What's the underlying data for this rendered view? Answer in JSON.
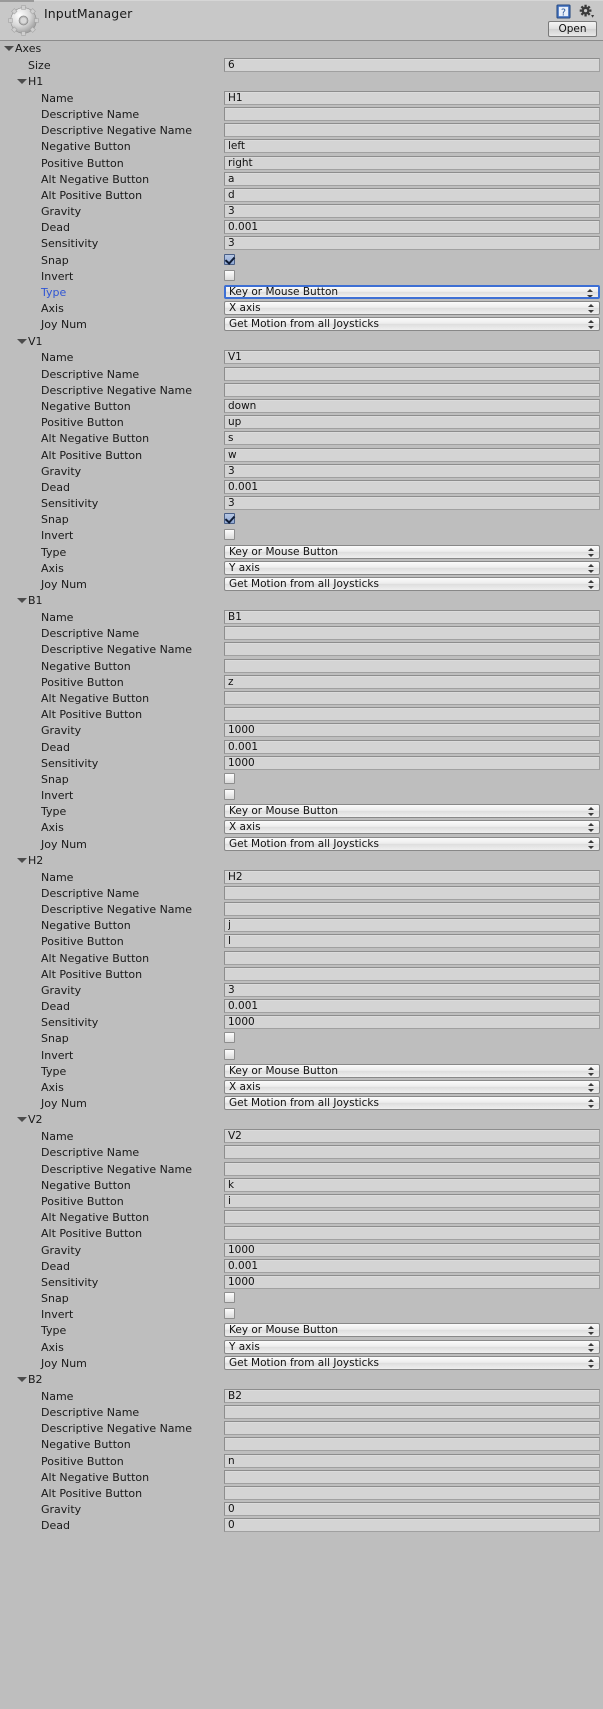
{
  "window": {
    "title": "InputManager",
    "logo_icon": "gear-icon",
    "help_icon": "help-book-icon",
    "settings_icon": "gear-settings-icon",
    "open_label": "Open"
  },
  "labels": {
    "axes": "Axes",
    "size": "Size",
    "name": "Name",
    "descriptive_name": "Descriptive Name",
    "descriptive_negative_name": "Descriptive Negative Name",
    "negative_button": "Negative Button",
    "positive_button": "Positive Button",
    "alt_negative_button": "Alt Negative Button",
    "alt_positive_button": "Alt Positive Button",
    "gravity": "Gravity",
    "dead": "Dead",
    "sensitivity": "Sensitivity",
    "snap": "Snap",
    "invert": "Invert",
    "type": "Type",
    "axis": "Axis",
    "joy_num": "Joy Num"
  },
  "colors": {
    "accent_blue": "#2f55d4",
    "focus_border": "#3d6fd4",
    "panel_bg": "#bebebe",
    "header_bg": "#c8c8c8",
    "field_bg": "#d4d4d4"
  },
  "axes": {
    "size": "6",
    "entries": [
      {
        "id": "H1",
        "name": "H1",
        "descriptive_name": "",
        "descriptive_negative_name": "",
        "negative_button": "left",
        "positive_button": "right",
        "alt_negative_button": "a",
        "alt_positive_button": "d",
        "gravity": "3",
        "dead": "0.001",
        "sensitivity": "3",
        "snap": true,
        "invert": false,
        "type": "Key or Mouse Button",
        "type_focused": true,
        "type_label_highlighted": true,
        "axis": "X axis",
        "joy_num": "Get Motion from all Joysticks"
      },
      {
        "id": "V1",
        "name": "V1",
        "descriptive_name": "",
        "descriptive_negative_name": "",
        "negative_button": "down",
        "positive_button": "up",
        "alt_negative_button": "s",
        "alt_positive_button": "w",
        "gravity": "3",
        "dead": "0.001",
        "sensitivity": "3",
        "snap": true,
        "invert": false,
        "type": "Key or Mouse Button",
        "type_focused": false,
        "type_label_highlighted": false,
        "axis": "Y axis",
        "joy_num": "Get Motion from all Joysticks"
      },
      {
        "id": "B1",
        "name": "B1",
        "descriptive_name": "",
        "descriptive_negative_name": "",
        "negative_button": "",
        "positive_button": "z",
        "alt_negative_button": "",
        "alt_positive_button": "",
        "gravity": "1000",
        "dead": "0.001",
        "sensitivity": "1000",
        "snap": false,
        "invert": false,
        "type": "Key or Mouse Button",
        "type_focused": false,
        "type_label_highlighted": false,
        "axis": "X axis",
        "joy_num": "Get Motion from all Joysticks"
      },
      {
        "id": "H2",
        "name": "H2",
        "descriptive_name": "",
        "descriptive_negative_name": "",
        "negative_button": "j",
        "positive_button": "l",
        "alt_negative_button": "",
        "alt_positive_button": "",
        "gravity": "3",
        "dead": "0.001",
        "sensitivity": "1000",
        "snap": false,
        "invert": false,
        "type": "Key or Mouse Button",
        "type_focused": false,
        "type_label_highlighted": false,
        "axis": "X axis",
        "joy_num": "Get Motion from all Joysticks"
      },
      {
        "id": "V2",
        "name": "V2",
        "descriptive_name": "",
        "descriptive_negative_name": "",
        "negative_button": "k",
        "positive_button": "i",
        "alt_negative_button": "",
        "alt_positive_button": "",
        "gravity": "1000",
        "dead": "0.001",
        "sensitivity": "1000",
        "snap": false,
        "invert": false,
        "type": "Key or Mouse Button",
        "type_focused": false,
        "type_label_highlighted": false,
        "axis": "Y axis",
        "joy_num": "Get Motion from all Joysticks"
      },
      {
        "id": "B2",
        "name": "B2",
        "descriptive_name": "",
        "descriptive_negative_name": "",
        "negative_button": "",
        "positive_button": "n",
        "alt_negative_button": "",
        "alt_positive_button": "",
        "gravity": "0",
        "dead": "0",
        "sensitivity": "",
        "snap": false,
        "invert": false,
        "type": "",
        "type_focused": false,
        "type_label_highlighted": false,
        "axis": "",
        "joy_num": "",
        "truncated_after": "dead"
      }
    ]
  }
}
